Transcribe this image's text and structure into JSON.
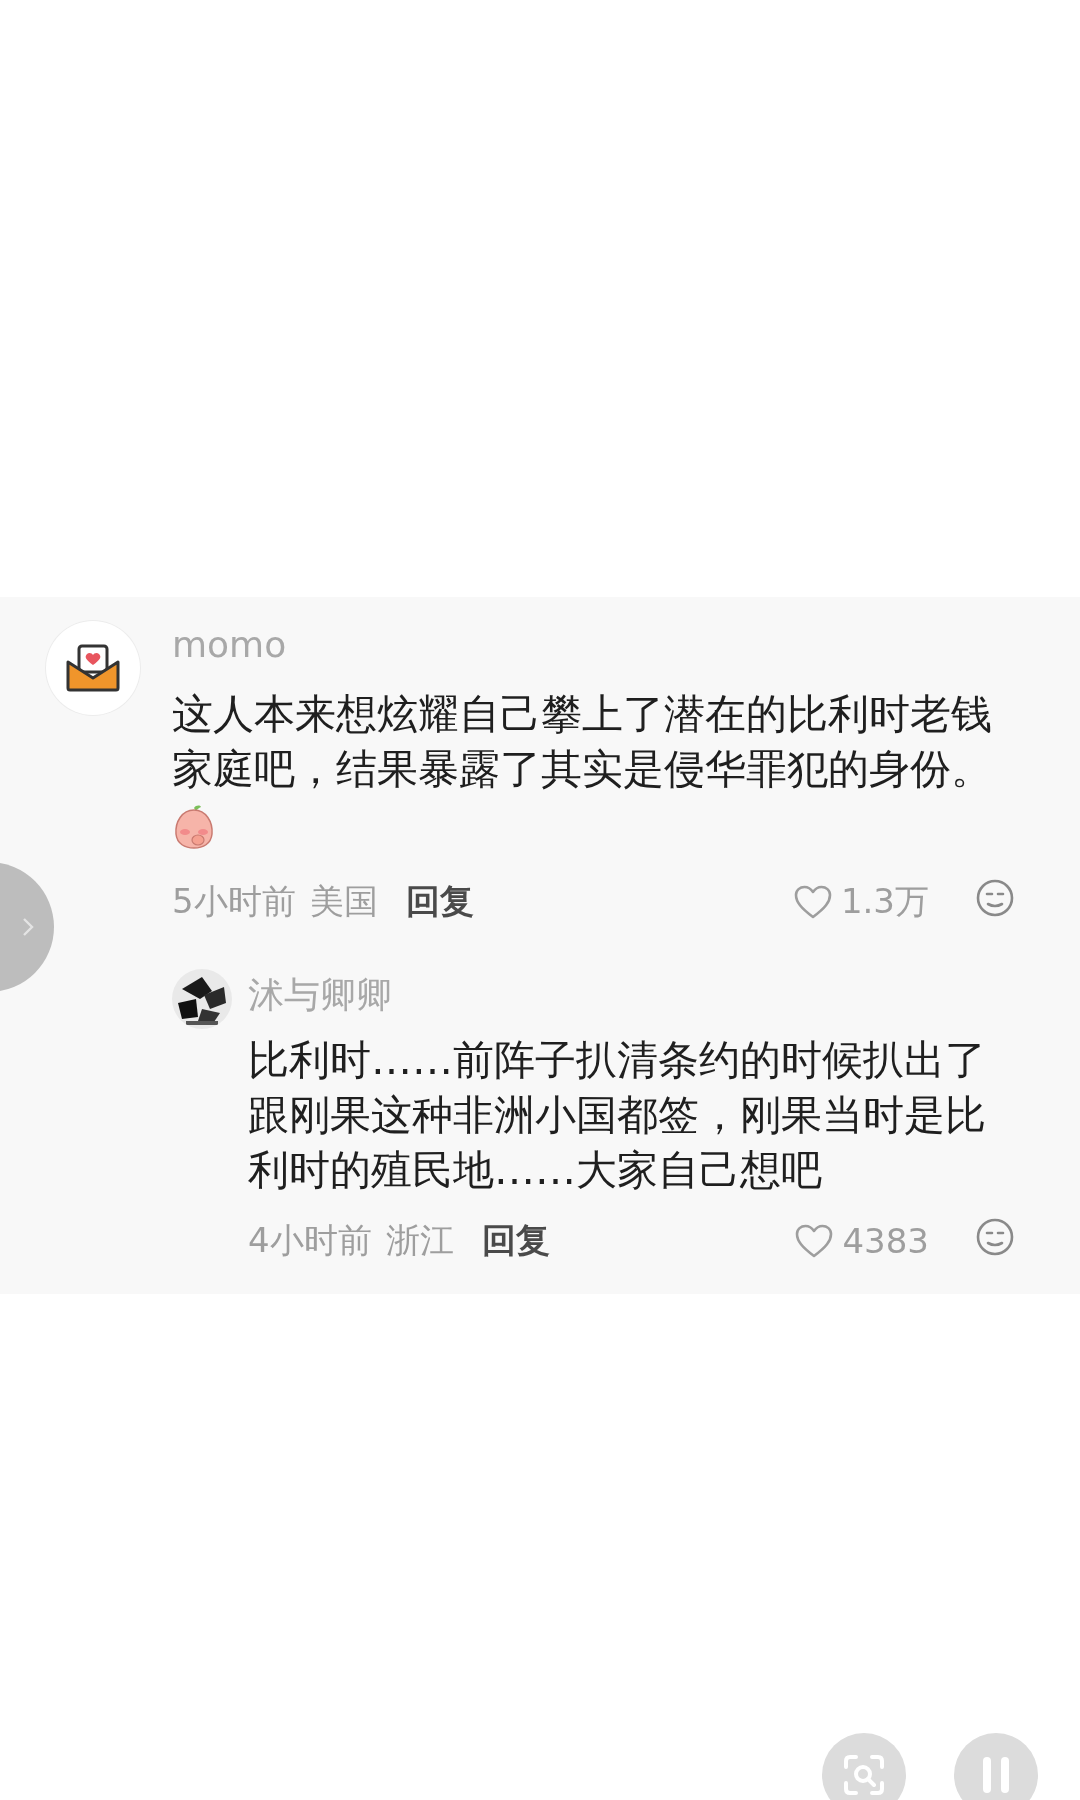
{
  "comments": [
    {
      "author": "momo",
      "text": "这人本来想炫耀自己攀上了潜在的比利时老钱家庭吧，结果暴露了其实是侵华罪犯的身份。",
      "sticker": true,
      "time": "5小时前",
      "location": "美国",
      "reply_label": "回复",
      "likes": "1.3万",
      "liked": false,
      "replies": [
        {
          "author": "沭与卿卿",
          "text": "比利时……前阵子扒清条约的时候扒出了跟刚果这种非洲小国都签，刚果当时是比利时的殖民地……大家自己想吧",
          "sticker": false,
          "time": "4小时前",
          "location": "浙江",
          "reply_label": "回复",
          "likes": "4383",
          "liked": false
        }
      ]
    }
  ]
}
